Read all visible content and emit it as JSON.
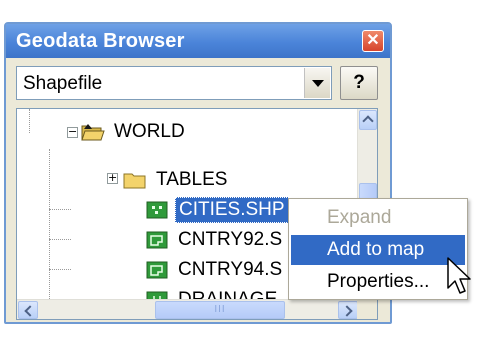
{
  "window": {
    "title": "Geodata Browser",
    "close_glyph": "✕"
  },
  "source_select": {
    "selected": "Shapefile"
  },
  "help_button": {
    "label": "?"
  },
  "tree": {
    "root": {
      "label": "WORLD",
      "expander": "−",
      "icon": "open-folder-icon"
    },
    "items": [
      {
        "label": "TABLES",
        "expander": "+",
        "icon": "folder-icon"
      },
      {
        "label": "CITIES.SHP",
        "icon": "point-layer-icon",
        "selected": true
      },
      {
        "label": "CNTRY92.S",
        "icon": "polygon-layer-icon"
      },
      {
        "label": "CNTRY94.S",
        "icon": "polygon-layer-icon"
      },
      {
        "label": "DRAINAGE",
        "icon": "line-layer-icon"
      }
    ]
  },
  "scrollbar": {
    "grip": "III"
  },
  "context_menu": {
    "items": [
      {
        "label": "Expand",
        "disabled": true
      },
      {
        "label": "Add to map",
        "hover": true
      },
      {
        "label": "Properties..."
      }
    ]
  },
  "colors": {
    "title_bar": "#4b84d9",
    "selection": "#316ac5",
    "folder": "#f3d36b",
    "layer_icon": "#2f9a3a"
  }
}
